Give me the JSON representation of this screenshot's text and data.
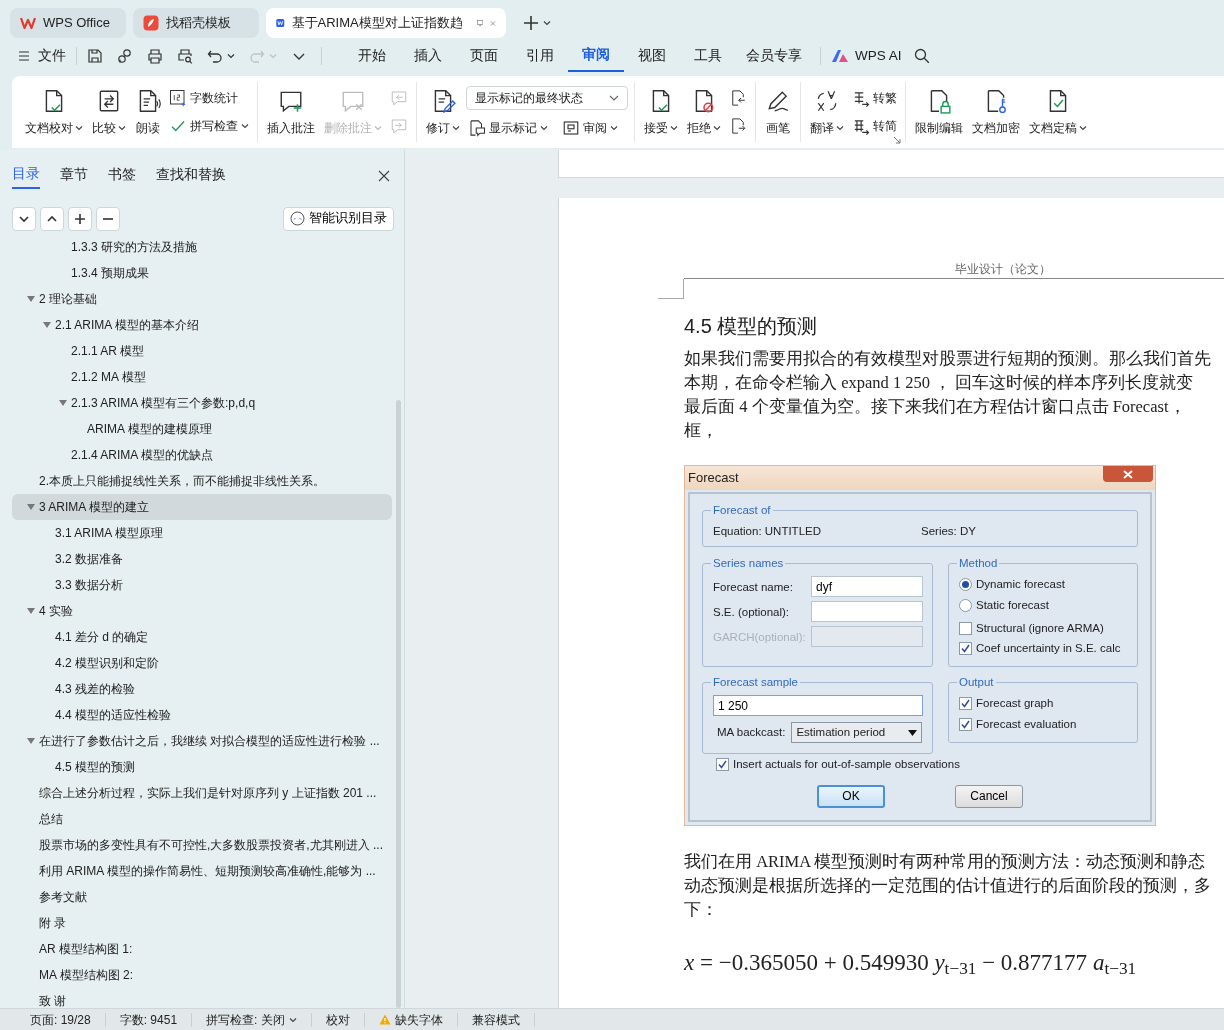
{
  "doc_tabs": [
    {
      "kind": "home",
      "label": "WPS Office",
      "selected": false
    },
    {
      "kind": "template",
      "label": "找稻壳模板",
      "selected": false
    },
    {
      "kind": "document",
      "label": "基于ARIMA模型对上证指数趋",
      "selected": true
    }
  ],
  "menu": {
    "file": "文件",
    "quick_access": [
      {
        "kind": "save",
        "disabled": false
      },
      {
        "kind": "link",
        "disabled": false
      },
      {
        "kind": "print",
        "disabled": false
      },
      {
        "kind": "preview",
        "disabled": false
      },
      {
        "kind": "undo",
        "disabled": false
      },
      {
        "kind": "redo",
        "disabled": true
      },
      {
        "kind": "more",
        "disabled": false
      }
    ],
    "tabs": [
      {
        "label": "开始",
        "selected": false
      },
      {
        "label": "插入",
        "selected": false
      },
      {
        "label": "页面",
        "selected": false
      },
      {
        "label": "引用",
        "selected": false
      },
      {
        "label": "审阅",
        "selected": true
      },
      {
        "label": "视图",
        "selected": false
      },
      {
        "label": "工具",
        "selected": false
      },
      {
        "label": "会员专享",
        "selected": false
      }
    ],
    "ai": "WPS AI"
  },
  "ribbon": [
    {
      "items": [
        {
          "kind": "large",
          "label": "文档校对",
          "dropdown": true,
          "disabled": false
        },
        {
          "kind": "large",
          "label": "比较",
          "dropdown": true,
          "disabled": false
        },
        {
          "kind": "large",
          "label": "朗读",
          "dropdown": false,
          "disabled": false
        },
        {
          "kind": "stack",
          "items": [
            {
              "kind": "small",
              "label": "字数统计",
              "dropdown": false,
              "disabled": false
            },
            {
              "kind": "small",
              "label": "拼写检查",
              "dropdown": true,
              "disabled": false
            }
          ]
        }
      ]
    },
    {
      "items": [
        {
          "kind": "large",
          "label": "插入批注",
          "dropdown": false,
          "disabled": false
        },
        {
          "kind": "large",
          "label": "删除批注",
          "dropdown": true,
          "disabled": true
        },
        {
          "kind": "stack",
          "items": [
            {
              "kind": "small",
              "dropdown": false,
              "disabled": true
            },
            {
              "kind": "small",
              "dropdown": false,
              "disabled": true
            }
          ]
        }
      ]
    },
    {
      "items": [
        {
          "kind": "large",
          "label": "修订",
          "dropdown": true,
          "disabled": false
        },
        {
          "kind": "stack",
          "items": [
            {
              "kind": "select",
              "value": "显示标记的最终状态"
            },
            {
              "kind": "row",
              "items": [
                {
                  "kind": "small",
                  "label": "显示标记",
                  "dropdown": true,
                  "disabled": false
                },
                {
                  "kind": "small",
                  "label": "审阅",
                  "dropdown": true,
                  "disabled": false
                }
              ]
            }
          ]
        }
      ]
    },
    {
      "items": [
        {
          "kind": "large",
          "label": "接受",
          "dropdown": true,
          "disabled": false
        },
        {
          "kind": "large",
          "label": "拒绝",
          "dropdown": true,
          "disabled": false
        },
        {
          "kind": "stack",
          "items": [
            {
              "kind": "small",
              "dropdown": false,
              "disabled": false
            },
            {
              "kind": "small",
              "dropdown": false,
              "disabled": false
            }
          ]
        }
      ]
    },
    {
      "items": [
        {
          "kind": "large",
          "label": "画笔",
          "dropdown": false,
          "disabled": false
        }
      ]
    },
    {
      "launcher": true,
      "items": [
        {
          "kind": "large",
          "label": "翻译",
          "dropdown": true,
          "disabled": false
        },
        {
          "kind": "stack",
          "items": [
            {
              "kind": "small",
              "label": "转繁",
              "dropdown": false,
              "disabled": false
            },
            {
              "kind": "small",
              "label": "转简",
              "dropdown": false,
              "disabled": false
            }
          ]
        }
      ]
    },
    {
      "items": [
        {
          "kind": "large",
          "label": "限制编辑",
          "dropdown": false,
          "disabled": false
        },
        {
          "kind": "large",
          "label": "文档加密",
          "dropdown": false,
          "disabled": false
        },
        {
          "kind": "large",
          "label": "文档定稿",
          "dropdown": true,
          "disabled": false
        }
      ]
    }
  ],
  "outline_panel": {
    "tabs": [
      {
        "label": "目录",
        "selected": true
      },
      {
        "label": "章节",
        "selected": false
      },
      {
        "label": "书签",
        "selected": false
      },
      {
        "label": "查找和替换",
        "selected": false
      }
    ],
    "tools": [
      {
        "kind": "expand"
      },
      {
        "kind": "collapse"
      },
      {
        "kind": "add"
      },
      {
        "kind": "remove"
      }
    ],
    "smart_button": "智能识别目录",
    "toc": [
      {
        "children": [
          {
            "children": [
              {
                "label": "1.3.3 研究的方法及措施",
                "selected": false
              },
              {
                "label": "1.3.4 预期成果",
                "selected": false
              }
            ]
          }
        ]
      },
      {
        "label": "2  理论基础",
        "selected": false,
        "expanded": true,
        "children": [
          {
            "label": "2.1 ARIMA 模型的基本介绍",
            "selected": false,
            "expanded": true,
            "children": [
              {
                "label": "2.1.1    AR 模型",
                "selected": false
              },
              {
                "label": "2.1.2    MA 模型",
                "selected": false
              },
              {
                "label": "2.1.3 ARIMA 模型有三个参数:p,d,q",
                "selected": false,
                "expanded": true,
                "children": [
                  {
                    "label": "ARIMA 模型的建模原理",
                    "selected": false
                  }
                ]
              },
              {
                "label": "2.1.4 ARIMA 模型的优缺点",
                "selected": false
              }
            ]
          }
        ]
      },
      {
        "label": "2.本质上只能捕捉线性关系，而不能捕捉非线性关系。",
        "selected": false
      },
      {
        "label": "3 ARIMA 模型的建立",
        "selected": true,
        "expanded": true,
        "children": [
          {
            "label": "3.1 ARIMA 模型原理",
            "selected": false
          },
          {
            "label": "3.2  数据准备",
            "selected": false
          },
          {
            "label": "3.3  数据分析",
            "selected": false
          }
        ]
      },
      {
        "label": "4  实验",
        "selected": false,
        "expanded": true,
        "children": [
          {
            "label": "4.1  差分 d 的确定",
            "selected": false
          },
          {
            "label": "4.2 模型识别和定阶",
            "selected": false
          },
          {
            "label": "4.3  残差的检验",
            "selected": false
          },
          {
            "label": "4.4 模型的适应性检验",
            "selected": false
          }
        ]
      },
      {
        "label": "在进行了参数估计之后，我继续 对拟合模型的适应性进行检验 ...",
        "selected": false,
        "expanded": true,
        "children": [
          {
            "label": "4.5 模型的预测",
            "selected": false
          }
        ]
      },
      {
        "label": "综合上述分析过程，实际上我们是针对原序列 y 上证指数 201 ...",
        "selected": false
      },
      {
        "label": "总结",
        "selected": false
      },
      {
        "label": "股票市场的多变性具有不可控性,大多数股票投资者,尤其刚进入 ...",
        "selected": false
      },
      {
        "label": "利用 ARIMA 模型的操作简易性、短期预测较高准确性,能够为 ...",
        "selected": false
      },
      {
        "label": "参考文献",
        "selected": false
      },
      {
        "label": "附  录",
        "selected": false
      },
      {
        "label": "AR 模型结构图 1:",
        "selected": false
      },
      {
        "label": "MA 模型结构图 2:",
        "selected": false
      },
      {
        "label": "致  谢",
        "selected": false
      }
    ]
  },
  "document": {
    "header": "毕业设计（论文）",
    "heading": "4.5 模型的预测",
    "paragraph_1": [
      "如果我们需要用拟合的有效模型对股票进行短期的预测。那么我们首先",
      "本期，在命令栏输入 expand 1 250 ， 回车这时候的样本序列长度就变",
      "最后面 4 个变量值为空。接下来我们在方程估计窗口点击 Forecast，",
      "框，"
    ],
    "forecast_dialog": {
      "title": "Forecast",
      "forecast_of": {
        "legend": "Forecast of",
        "equation": "Equation: UNTITLED",
        "series": "Series: DY"
      },
      "series_names": {
        "legend": "Series names",
        "fields": [
          {
            "label": "Forecast name:",
            "value": "dyf",
            "disabled": false
          },
          {
            "label": "S.E. (optional):",
            "disabled": false
          },
          {
            "label": "GARCH(optional):",
            "disabled": true
          }
        ]
      },
      "method": {
        "legend": "Method",
        "options": [
          {
            "kind": "radio",
            "label": "Dynamic forecast",
            "selected": true
          },
          {
            "kind": "radio",
            "label": "Static forecast",
            "selected": false
          },
          {
            "kind": "checkbox",
            "label": "Structural (ignore ARMA)",
            "checked": false
          },
          {
            "kind": "checkbox",
            "label": "Coef uncertainty in S.E. calc",
            "checked": true
          }
        ]
      },
      "forecast_sample": {
        "legend": "Forecast sample",
        "value": "1 250",
        "ma_backcast": {
          "label": "MA backcast:",
          "value": "Estimation period"
        }
      },
      "output": {
        "legend": "Output",
        "options": [
          {
            "label": "Forecast graph",
            "checked": true
          },
          {
            "label": "Forecast evaluation",
            "checked": true
          }
        ]
      },
      "insert_actuals": {
        "label": "Insert actuals for out-of-sample observations",
        "checked": true
      },
      "buttons": [
        {
          "label": "OK",
          "default": true
        },
        {
          "label": "Cancel",
          "default": false
        }
      ]
    },
    "paragraph_2": [
      "我们在用 ARIMA 模型预测时有两种常用的预测方法：动态预测和静态",
      "动态预测是根据所选择的一定范围的估计值进行的后面阶段的预测，多",
      "下："
    ],
    "equation": "*x* = −0.365050 + 0.549930 *y*$_{t−31}$ − 0.877177 *a*$_{t−31}$"
  },
  "status_bar": [
    {
      "kind": "text",
      "label": "页面: 19/28"
    },
    {
      "kind": "text",
      "label": "字数: 9451"
    },
    {
      "kind": "dropdown",
      "label": "拼写检查: 关闭"
    },
    {
      "kind": "text",
      "label": "校对"
    },
    {
      "kind": "warning",
      "label": "缺失字体"
    },
    {
      "kind": "text",
      "label": "兼容模式"
    }
  ]
}
